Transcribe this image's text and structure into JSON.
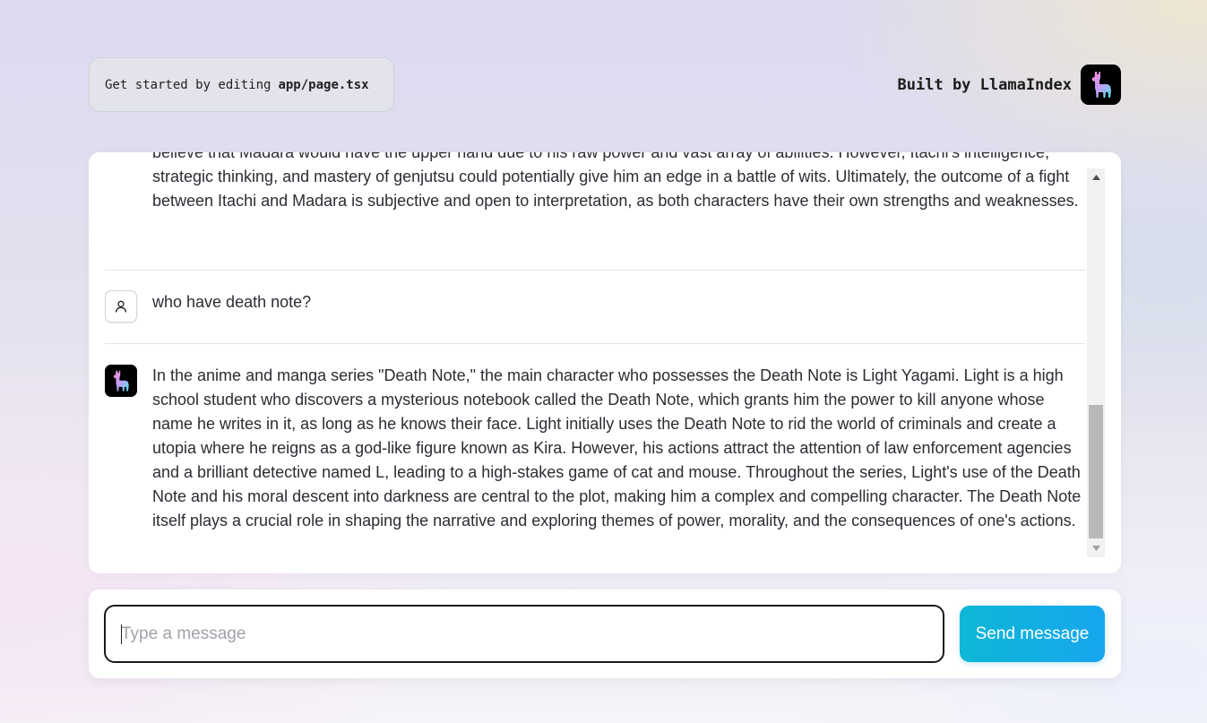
{
  "header": {
    "edit_hint_text": "Get started by editing",
    "edit_hint_code": "app/page.tsx",
    "built_by_text": "Built by LlamaIndex"
  },
  "chat": {
    "messages": [
      {
        "role": "assistant",
        "avatar_icon": "llama-icon",
        "text": "believe that Madara would have the upper hand due to his raw power and vast array of abilities. However, Itachi's intelligence, strategic thinking, and mastery of genjutsu could potentially give him an edge in a battle of wits. Ultimately, the outcome of a fight between Itachi and Madara is subjective and open to interpretation, as both characters have their own strengths and weaknesses."
      },
      {
        "role": "user",
        "avatar_icon": "user-icon",
        "text": "who have death note?"
      },
      {
        "role": "assistant",
        "avatar_icon": "llama-icon",
        "text": "In the anime and manga series \"Death Note,\" the main character who possesses the Death Note is Light Yagami. Light is a high school student who discovers a mysterious notebook called the Death Note, which grants him the power to kill anyone whose name he writes in it, as long as he knows their face. Light initially uses the Death Note to rid the world of criminals and create a utopia where he reigns as a god-like figure known as Kira. However, his actions attract the attention of law enforcement agencies and a brilliant detective named L, leading to a high-stakes game of cat and mouse. Throughout the series, Light's use of the Death Note and his moral descent into darkness are central to the plot, making him a complex and compelling character. The Death Note itself plays a crucial role in shaping the narrative and exploring themes of power, morality, and the consequences of one's actions."
      }
    ]
  },
  "composer": {
    "placeholder": "Type a message",
    "value": "",
    "send_label": "Send message"
  },
  "colors": {
    "send_gradient_start": "#0eb7d6",
    "send_gradient_end": "#17a6ee",
    "logo_bg": "#000000"
  }
}
